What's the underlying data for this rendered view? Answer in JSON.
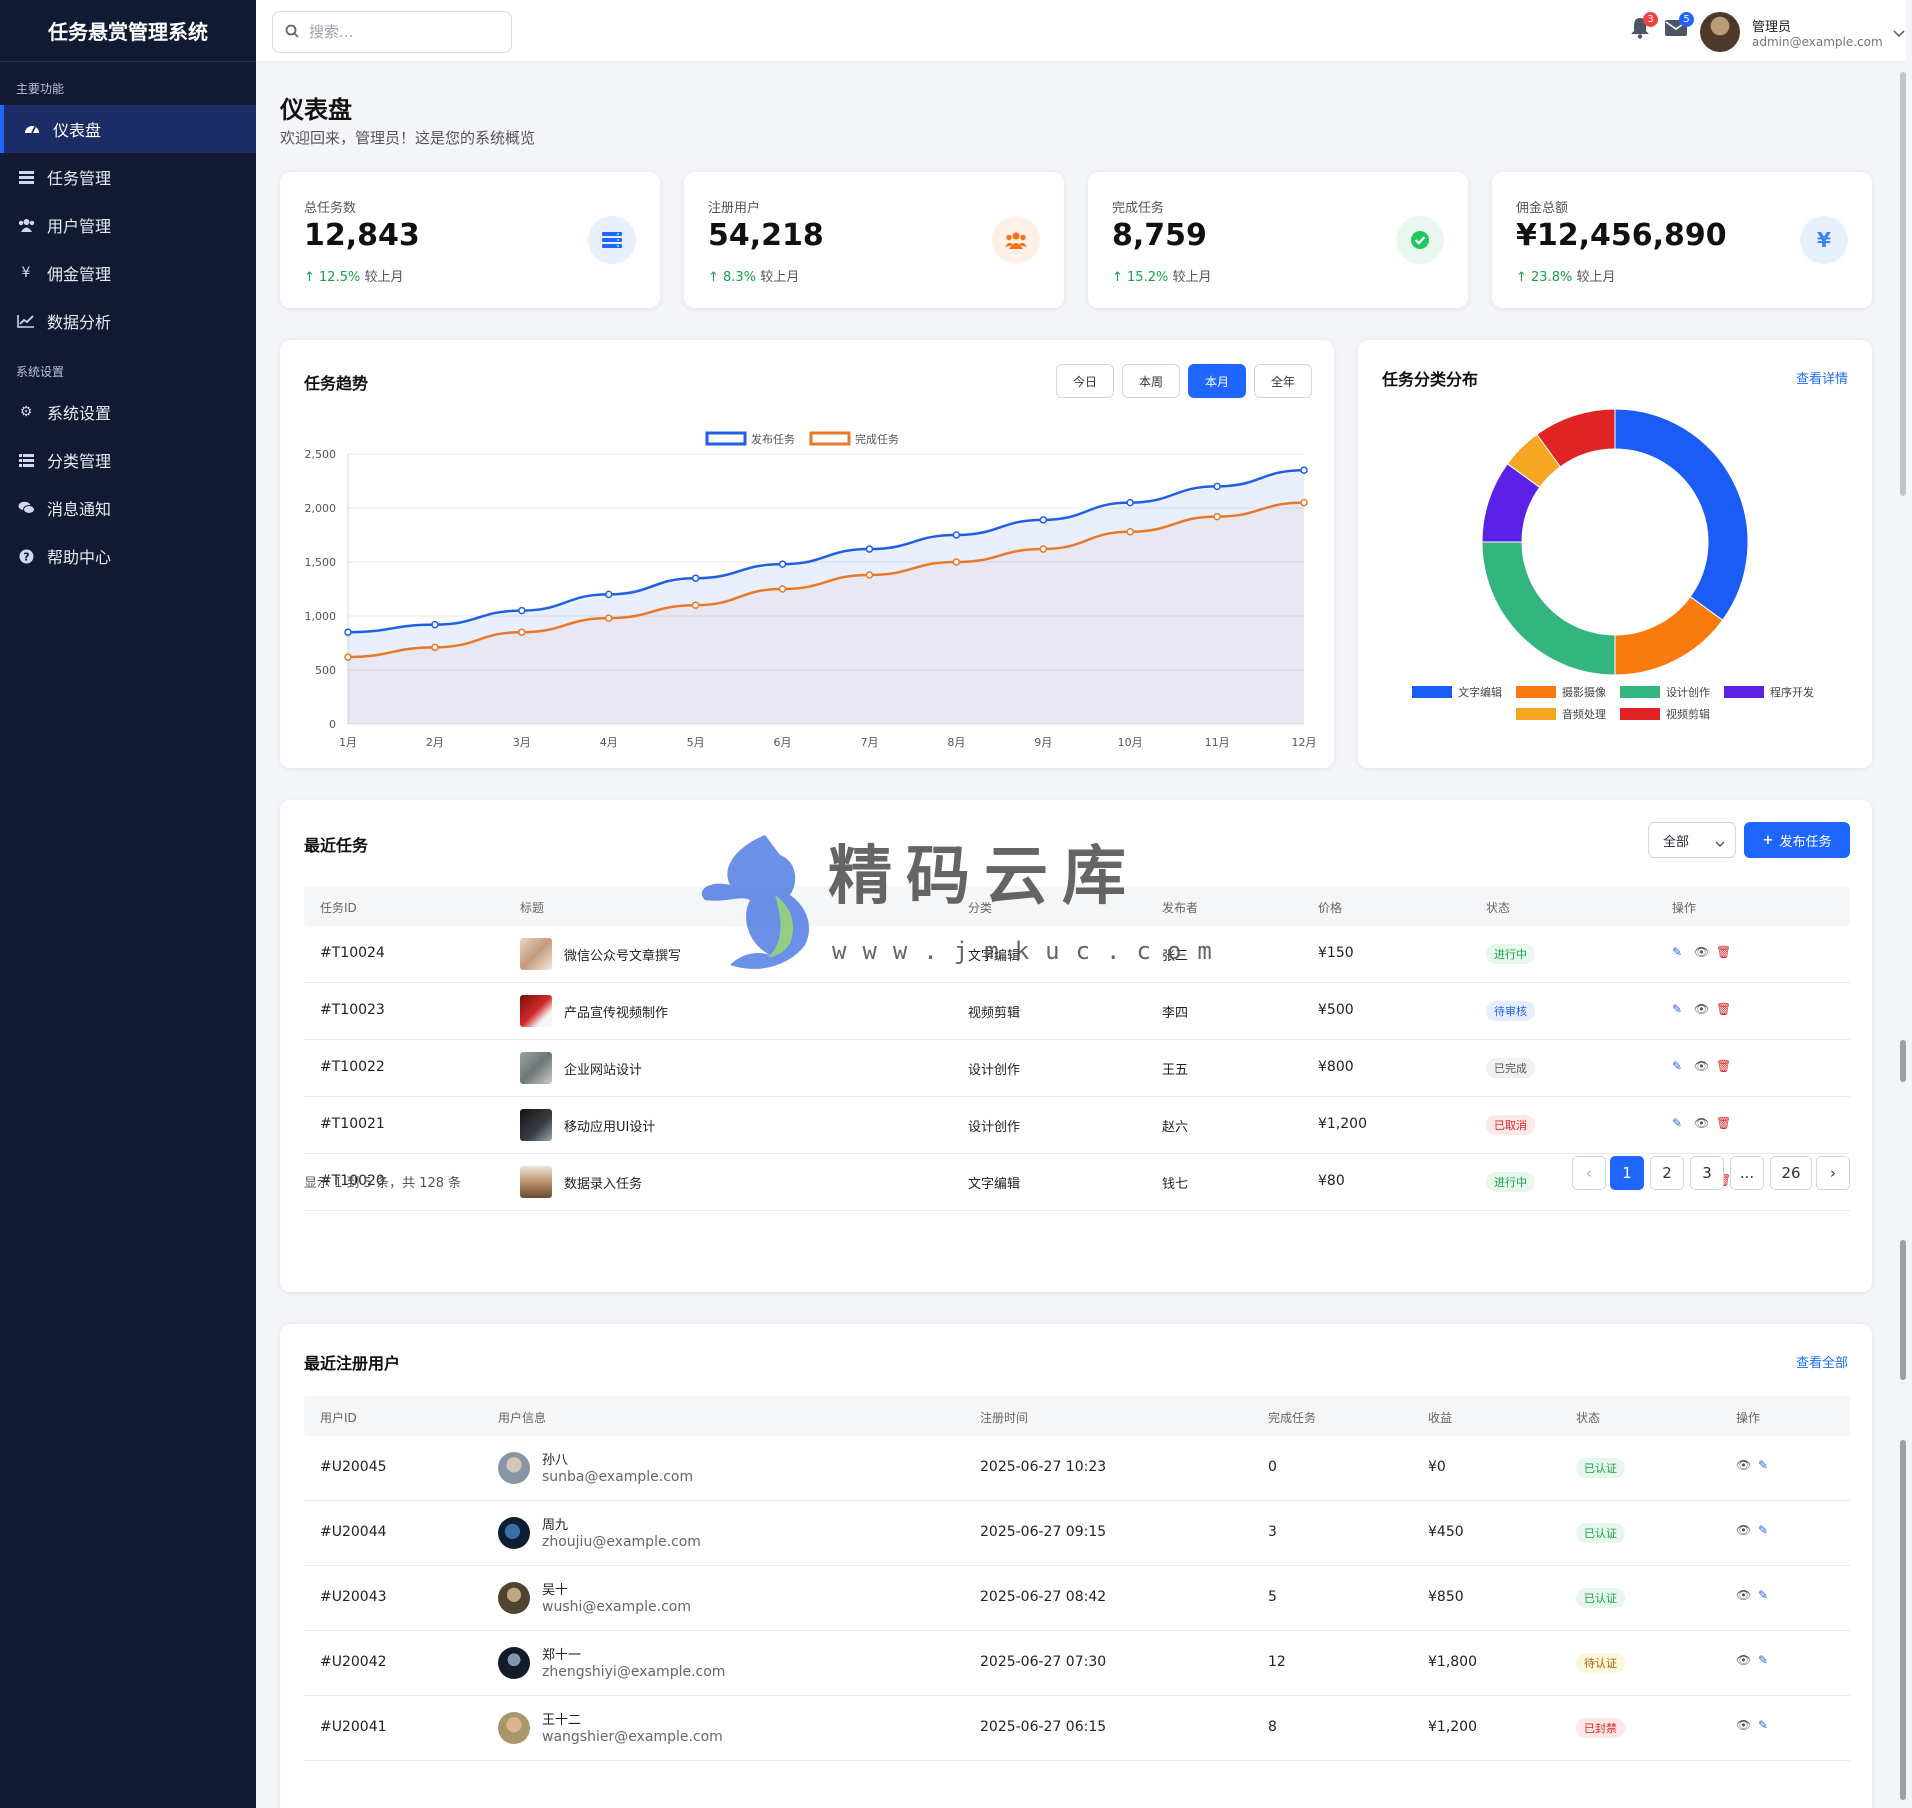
{
  "app": {
    "title": "任务悬赏管理系统"
  },
  "sidebar": {
    "sections": [
      {
        "label": "主要功能"
      },
      {
        "label": "系统设置"
      }
    ],
    "items": [
      {
        "label": "仪表盘",
        "icon": "dashboard-icon"
      },
      {
        "label": "任务管理",
        "icon": "tasks-icon"
      },
      {
        "label": "用户管理",
        "icon": "users-icon"
      },
      {
        "label": "佣金管理",
        "icon": "yen-icon"
      },
      {
        "label": "数据分析",
        "icon": "chart-line-icon"
      },
      {
        "label": "系统设置",
        "icon": "gear-icon"
      },
      {
        "label": "分类管理",
        "icon": "list-icon"
      },
      {
        "label": "消息通知",
        "icon": "comments-icon"
      },
      {
        "label": "帮助中心",
        "icon": "question-icon"
      }
    ]
  },
  "header": {
    "search_placeholder": "搜索...",
    "notifications_count": "3",
    "messages_count": "5",
    "user_name": "管理员",
    "user_email": "admin@example.com"
  },
  "page": {
    "title": "仪表盘",
    "subtitle": "欢迎回来，管理员！这是您的系统概览"
  },
  "stats": [
    {
      "label": "总任务数",
      "value": "12,843",
      "change": "12.5%",
      "compare": "较上月",
      "icon": "server-icon",
      "color": "#1f66ff",
      "bg": "#e8efff"
    },
    {
      "label": "注册用户",
      "value": "54,218",
      "change": "8.3%",
      "compare": "较上月",
      "icon": "users-icon",
      "color": "#f97316",
      "bg": "#fff1e6"
    },
    {
      "label": "完成任务",
      "value": "8,759",
      "change": "15.2%",
      "compare": "较上月",
      "icon": "check-circle-icon",
      "color": "#22c55e",
      "bg": "#e8f8ee"
    },
    {
      "label": "佣金总额",
      "value": "¥12,456,890",
      "change": "23.8%",
      "compare": "较上月",
      "icon": "yen-icon",
      "color": "#3b82f6",
      "bg": "#e6f0ff"
    }
  ],
  "trend": {
    "title": "任务趋势",
    "ranges": [
      "今日",
      "本周",
      "本月",
      "全年"
    ],
    "active_range": "本月"
  },
  "chart_data": [
    {
      "type": "line",
      "title": "任务趋势",
      "x": [
        "1月",
        "2月",
        "3月",
        "4月",
        "5月",
        "6月",
        "7月",
        "8月",
        "9月",
        "10月",
        "11月",
        "12月"
      ],
      "series": [
        {
          "name": "发布任务",
          "color": "#1f5fe6",
          "values": [
            850,
            920,
            1050,
            1200,
            1350,
            1480,
            1620,
            1750,
            1890,
            2050,
            2200,
            2350
          ]
        },
        {
          "name": "完成任务",
          "color": "#e8792b",
          "values": [
            620,
            710,
            850,
            980,
            1100,
            1250,
            1380,
            1500,
            1620,
            1780,
            1920,
            2050
          ]
        }
      ],
      "ylim": [
        0,
        2500
      ],
      "yticks": [
        0,
        500,
        1000,
        1500,
        2000,
        2500
      ],
      "grid": true,
      "legend": "top"
    },
    {
      "type": "pie",
      "title": "任务分类分布",
      "categories": [
        "文字编辑",
        "摄影摄像",
        "设计创作",
        "程序开发",
        "音频处理",
        "视频剪辑"
      ],
      "values": [
        35,
        15,
        25,
        10,
        5,
        10
      ],
      "colors": [
        "#1a5cf5",
        "#f97a0f",
        "#33b57f",
        "#5b21e6",
        "#f5a623",
        "#e02424"
      ],
      "legend": "bottom"
    }
  ],
  "category": {
    "title": "任务分类分布",
    "link": "查看详情"
  },
  "tasks": {
    "title": "最近任务",
    "filter": "全部",
    "publish_button": "发布任务",
    "columns": [
      "任务ID",
      "标题",
      "分类",
      "发布者",
      "价格",
      "状态",
      "操作"
    ],
    "rows": [
      {
        "id": "#T10024",
        "title": "微信公众号文章撰写",
        "category": "文字编辑",
        "publisher": "张三",
        "price": "¥150",
        "status": "进行中"
      },
      {
        "id": "#T10023",
        "title": "产品宣传视频制作",
        "category": "视频剪辑",
        "publisher": "李四",
        "price": "¥500",
        "status": "待审核"
      },
      {
        "id": "#T10022",
        "title": "企业网站设计",
        "category": "设计创作",
        "publisher": "王五",
        "price": "¥800",
        "status": "已完成"
      },
      {
        "id": "#T10021",
        "title": "移动应用UI设计",
        "category": "设计创作",
        "publisher": "赵六",
        "price": "¥1,200",
        "status": "已取消"
      },
      {
        "id": "#T10020",
        "title": "数据录入任务",
        "category": "文字编辑",
        "publisher": "钱七",
        "price": "¥80",
        "status": "进行中"
      }
    ],
    "summary": "显示 1 到 5 条，共 128 条",
    "pages": [
      "1",
      "2",
      "3",
      "...",
      "26"
    ],
    "current_page": "1"
  },
  "users": {
    "title": "最近注册用户",
    "link": "查看全部",
    "columns": [
      "用户ID",
      "用户信息",
      "注册时间",
      "完成任务",
      "收益",
      "状态",
      "操作"
    ],
    "rows": [
      {
        "id": "#U20045",
        "name": "孙八",
        "email": "sunba@example.com",
        "time": "2025-06-27 10:23",
        "done": "0",
        "income": "¥0",
        "status": "已认证"
      },
      {
        "id": "#U20044",
        "name": "周九",
        "email": "zhoujiu@example.com",
        "time": "2025-06-27 09:15",
        "done": "3",
        "income": "¥450",
        "status": "已认证"
      },
      {
        "id": "#U20043",
        "name": "吴十",
        "email": "wushi@example.com",
        "time": "2025-06-27 08:42",
        "done": "5",
        "income": "¥850",
        "status": "已认证"
      },
      {
        "id": "#U20042",
        "name": "郑十一",
        "email": "zhengshiyi@example.com",
        "time": "2025-06-27 07:30",
        "done": "12",
        "income": "¥1,800",
        "status": "待认证"
      },
      {
        "id": "#U20041",
        "name": "王十二",
        "email": "wangshier@example.com",
        "time": "2025-06-27 06:15",
        "done": "8",
        "income": "¥1,200",
        "status": "已封禁"
      }
    ]
  },
  "watermark": {
    "title": "精码云库",
    "url": "www.jmkuc.com"
  }
}
